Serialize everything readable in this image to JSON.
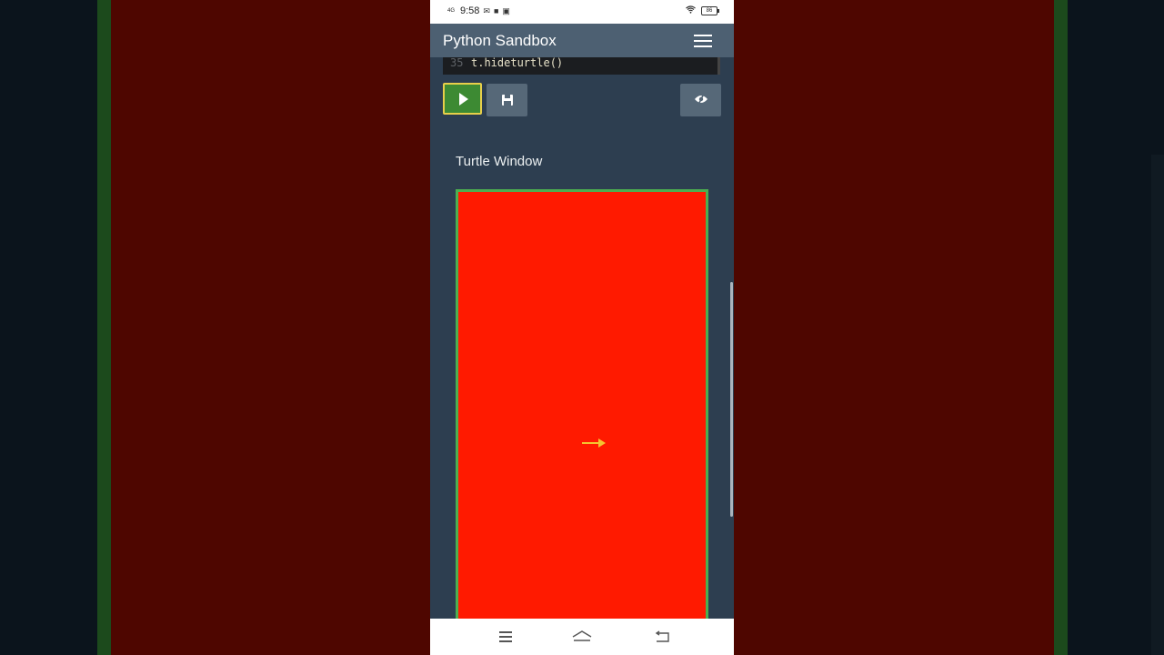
{
  "status_bar": {
    "network": "4G",
    "time": "9:58",
    "battery": "86"
  },
  "app": {
    "title": "Python Sandbox"
  },
  "editor": {
    "line_number": "35",
    "code_line": "t.hideturtle()"
  },
  "turtle": {
    "section_label": "Turtle Window",
    "canvas_color": "#ff1a00",
    "border_color": "#4caf50",
    "arrow_color": "#f4c430"
  },
  "colors": {
    "app_background": "#2d3e50",
    "app_bar": "#4d6072",
    "run_button": "#3d8a33",
    "run_button_outline": "#e7cf4a"
  }
}
